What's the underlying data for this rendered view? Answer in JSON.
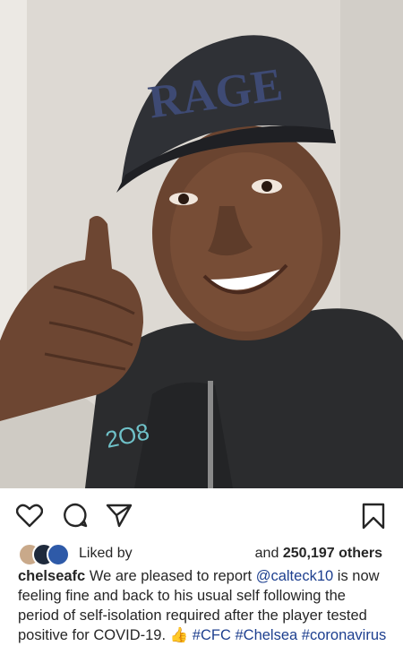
{
  "post": {
    "photo_alt": "Selfie of player in cap giving thumbs up",
    "cap_text": "RAGE"
  },
  "actions": {
    "like_icon": "heart-icon",
    "comment_icon": "comment-icon",
    "share_icon": "paper-plane-icon",
    "save_icon": "bookmark-icon"
  },
  "likes": {
    "liked_by_label": "Liked by",
    "and_label": "and",
    "count": "250,197 others"
  },
  "caption": {
    "username": "chelseafc",
    "text_1": "We are pleased to report",
    "mention": "@calteck10",
    "text_2": "is now feeling fine and back to his usual self following the period of self-isolation required after the player tested positive for COVID-19.",
    "emoji": "👍",
    "tag_1": "#CFC",
    "tag_2": "#Chelsea",
    "tag_3": "#coronavirus"
  },
  "colors": {
    "link": "#1d3f8f",
    "text": "#262626"
  }
}
